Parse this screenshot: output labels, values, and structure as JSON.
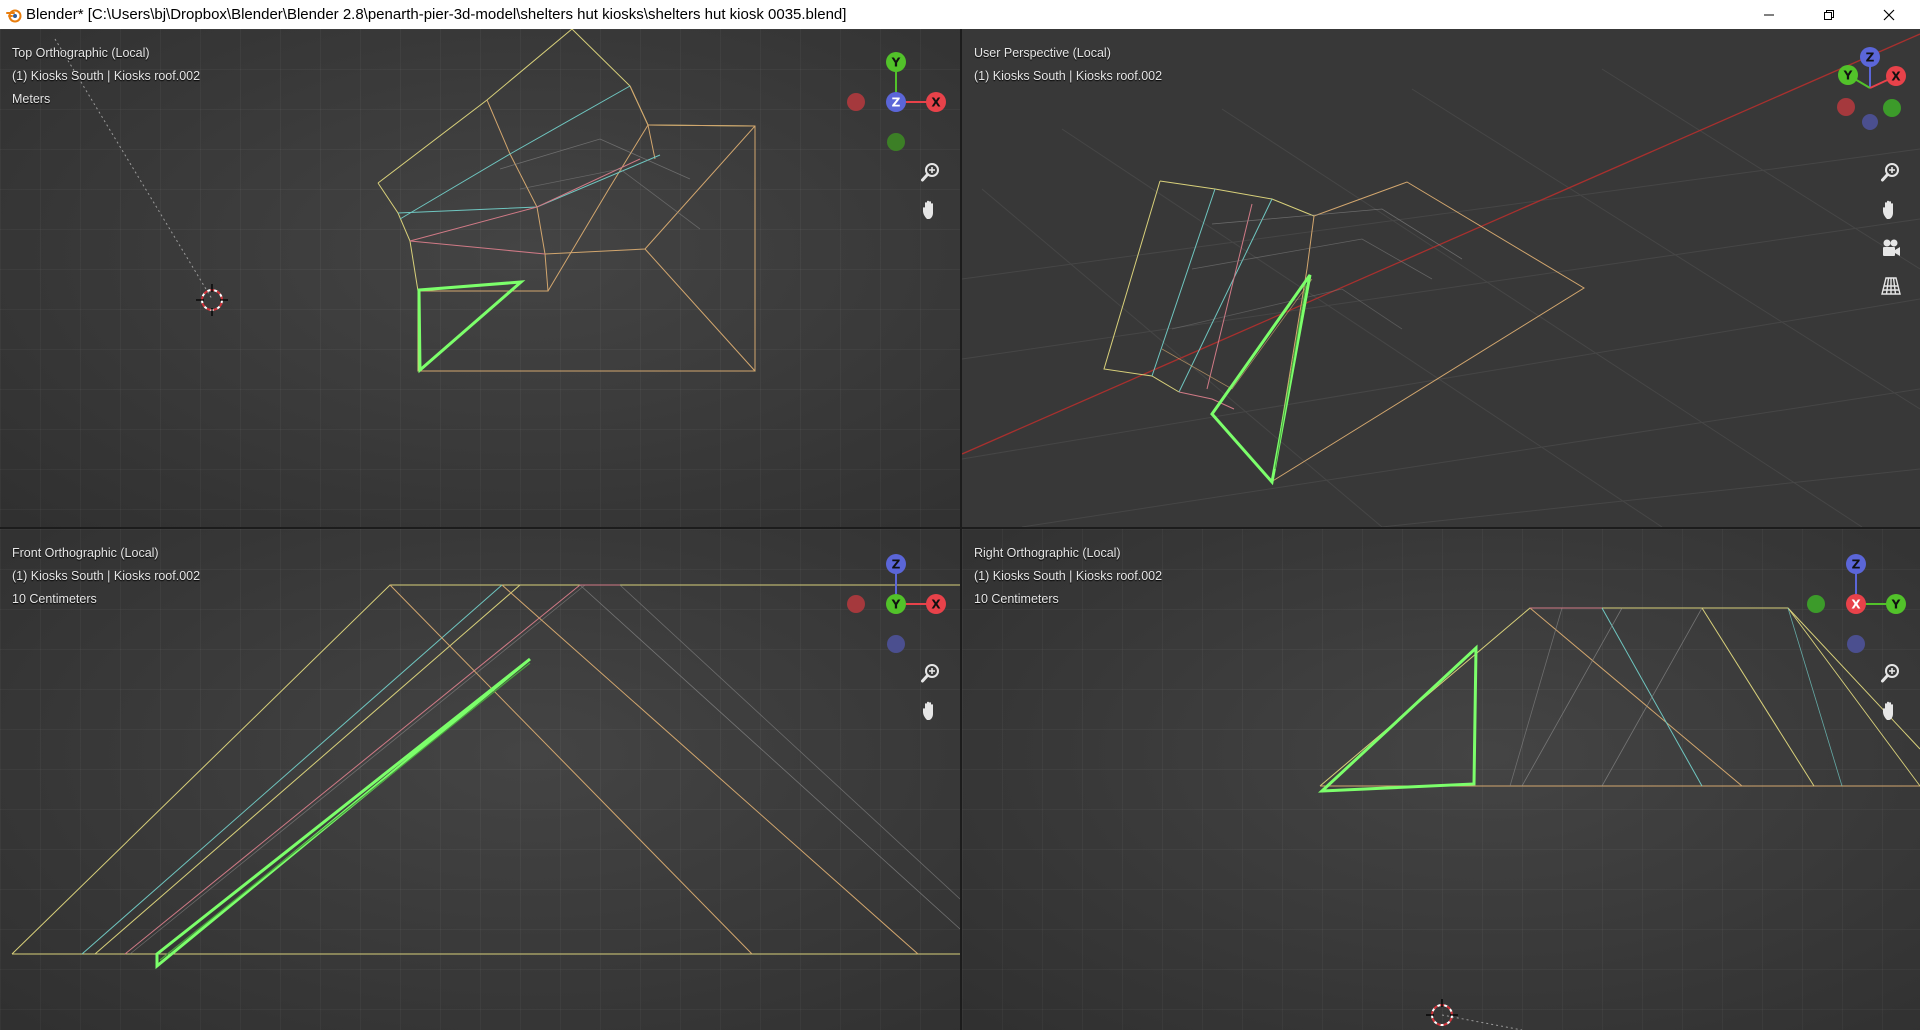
{
  "window": {
    "title": "Blender* [C:\\Users\\bj\\Dropbox\\Blender\\Blender 2.8\\penarth-pier-3d-model\\shelters hut kiosks\\shelters hut kiosk 0035.blend]",
    "app_icon": "blender-icon",
    "controls": [
      "minimize-icon",
      "restore-icon",
      "close-icon"
    ]
  },
  "axis_colors": {
    "x": "#e8424a",
    "y": "#52c22a",
    "z": "#5b66d8",
    "x_dim": "#a5393d",
    "y_dim": "#3c7f26",
    "z_dim": "#4b4f8f"
  },
  "wire_colors": {
    "selected": "#7cff6b",
    "edge_yellow": "#d8d07a",
    "edge_orange": "#d2a66e",
    "edge_cyan": "#6fc6c0",
    "edge_pink": "#d07a86"
  },
  "viewports": {
    "top": {
      "view_name": "Top Orthographic (Local)",
      "object": "(1) Kiosks South | Kiosks roof.002",
      "scale": "Meters",
      "gizmo": {
        "center": "Z",
        "right": "X",
        "up": "Y"
      },
      "tools": [
        "zoom-icon",
        "pan-hand-icon"
      ]
    },
    "user": {
      "view_name": "User Perspective (Local)",
      "object": "(1) Kiosks South | Kiosks roof.002",
      "gizmo": {
        "top": "Z",
        "left": "Y",
        "right": "X"
      },
      "tools": [
        "zoom-icon",
        "pan-hand-icon",
        "camera-icon",
        "grid-perspective-icon"
      ]
    },
    "front": {
      "view_name": "Front Orthographic (Local)",
      "object": "(1) Kiosks South | Kiosks roof.002",
      "scale": "10 Centimeters",
      "gizmo": {
        "center": "Y",
        "right": "X",
        "up": "Z"
      },
      "tools": [
        "zoom-icon",
        "pan-hand-icon"
      ]
    },
    "right": {
      "view_name": "Right Orthographic (Local)",
      "object": "(1) Kiosks South | Kiosks roof.002",
      "scale": "10 Centimeters",
      "gizmo": {
        "center": "X",
        "right": "Y",
        "up": "Z"
      },
      "tools": [
        "zoom-icon",
        "pan-hand-icon"
      ]
    }
  }
}
